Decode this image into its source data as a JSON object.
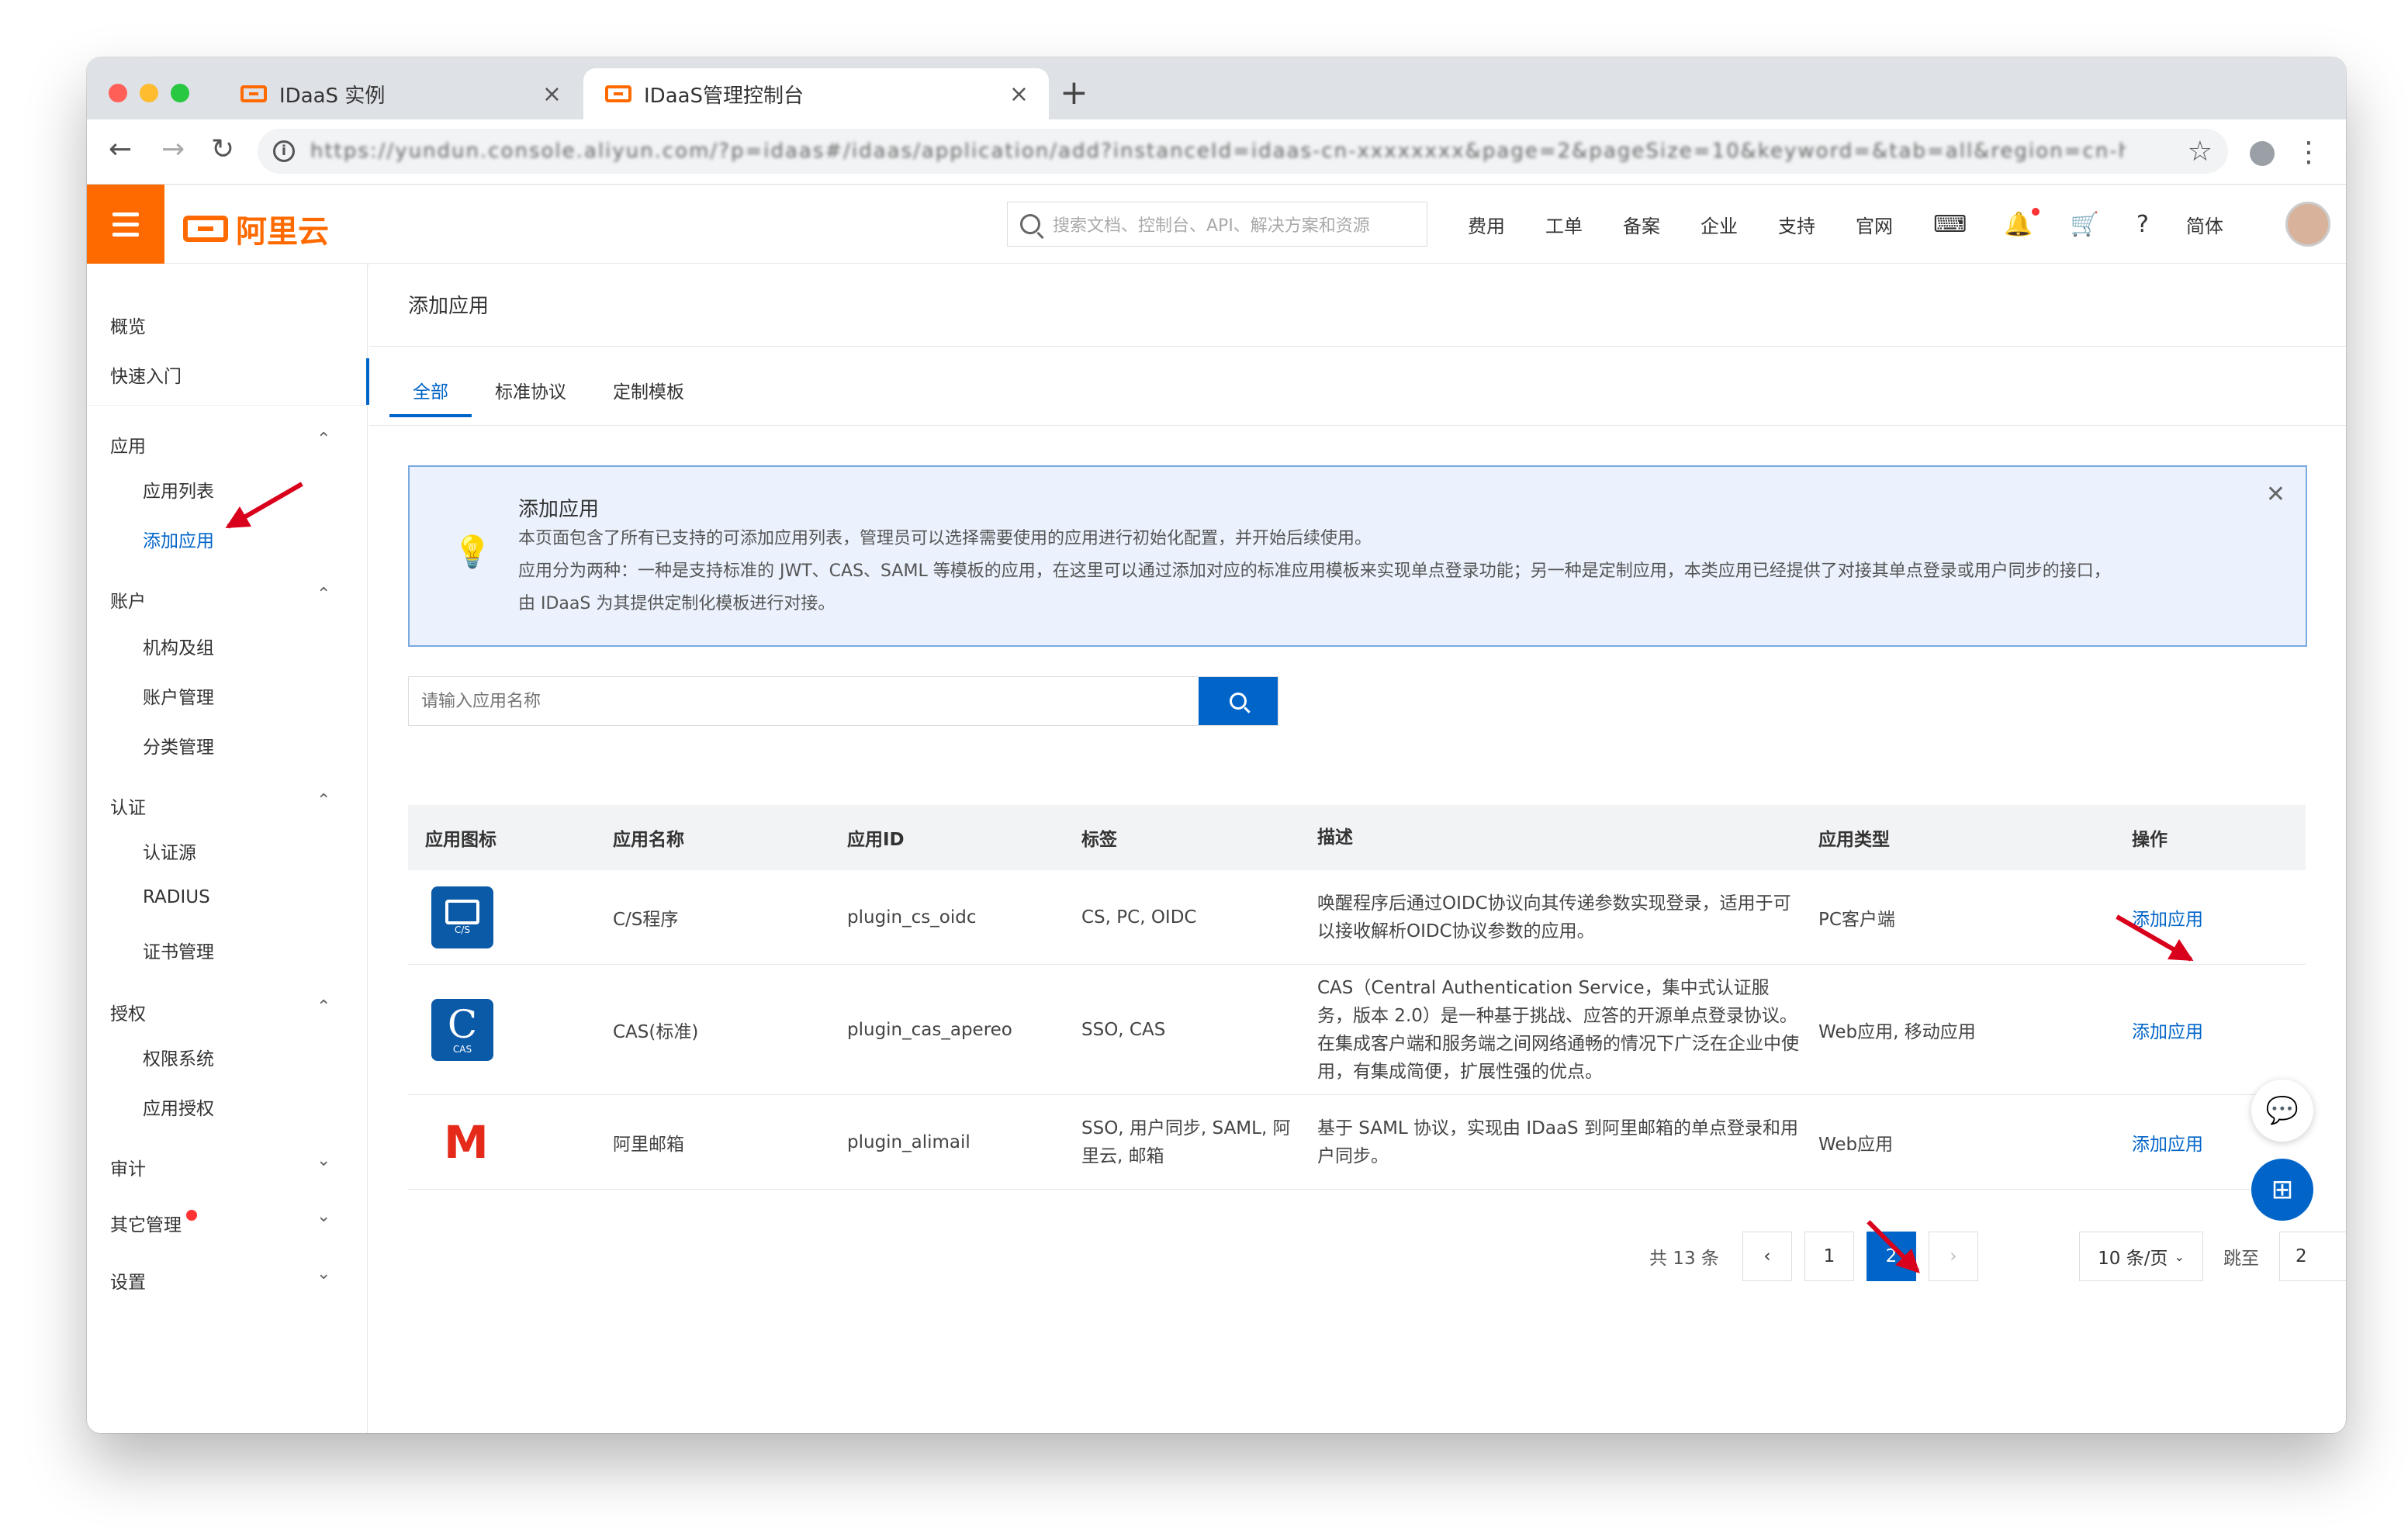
{
  "browser": {
    "tabs": [
      {
        "label": "IDaaS 实例",
        "active": false
      },
      {
        "label": "IDaaS管理控制台",
        "active": true
      }
    ],
    "url": "https://yundun.console.aliyun.com/?p=idaas#/idaas/application/add?instanceId=idaas-cn-xxxxxxxx&page=2&pageSize=10&keyword=&tab=all&region=cn-hangzhou"
  },
  "topbar": {
    "brand": "阿里云",
    "search_placeholder": "搜索文档、控制台、API、解决方案和资源",
    "nav": [
      "费用",
      "工单",
      "备案",
      "企业",
      "支持",
      "官网"
    ],
    "lang": "简体",
    "accent": "#ff6a00"
  },
  "sidebar": {
    "top_items": [
      "概览",
      "快速入门"
    ],
    "groups": [
      {
        "label": "应用",
        "expanded": true,
        "items": [
          "应用列表",
          "添加应用"
        ]
      },
      {
        "label": "账户",
        "expanded": true,
        "items": [
          "机构及组",
          "账户管理",
          "分类管理"
        ]
      },
      {
        "label": "认证",
        "expanded": true,
        "items": [
          "认证源",
          "RADIUS",
          "证书管理"
        ]
      },
      {
        "label": "授权",
        "expanded": true,
        "items": [
          "权限系统",
          "应用授权"
        ]
      },
      {
        "label": "审计",
        "expanded": false,
        "items": []
      },
      {
        "label": "其它管理",
        "expanded": false,
        "items": []
      },
      {
        "label": "设置",
        "expanded": false,
        "items": []
      }
    ],
    "active_item": "添加应用"
  },
  "page": {
    "title": "添加应用",
    "tabs": [
      "全部",
      "标准协议",
      "定制模板"
    ],
    "active_tab": "全部"
  },
  "notice": {
    "title": "添加应用",
    "line1": "本页面包含了所有已支持的可添加应用列表，管理员可以选择需要使用的应用进行初始化配置，并开始后续使用。",
    "line2": "应用分为两种：一种是支持标准的 JWT、CAS、SAML 等模板的应用，在这里可以通过添加对应的标准应用模板来实现单点登录功能；另一种是定制应用，本类应用已经提供了对接其单点登录或用户同步的接口，",
    "line3": "由 IDaaS 为其提供定制化模板进行对接。"
  },
  "search": {
    "placeholder": "请输入应用名称",
    "value": ""
  },
  "table": {
    "headers": [
      "应用图标",
      "应用名称",
      "应用ID",
      "标签",
      "描述",
      "应用类型",
      "操作"
    ],
    "rows": [
      {
        "icon": "cs-monitor-icon",
        "icon_text": "C/S",
        "name": "C/S程序",
        "id": "plugin_cs_oidc",
        "tags": "CS, PC, OIDC",
        "desc": "唤醒程序后通过OIDC协议向其传递参数实现登录，适用于可以接收解析OIDC协议参数的应用。",
        "type": "PC客户端",
        "action": "添加应用"
      },
      {
        "icon": "cas-icon",
        "icon_text": "C",
        "icon_sub": "CAS",
        "name": "CAS(标准)",
        "id": "plugin_cas_apereo",
        "tags": "SSO, CAS",
        "desc": "CAS（Central Authentication Service，集中式认证服务，版本 2.0）是一种基于挑战、应答的开源单点登录协议。在集成客户端和服务端之间网络通畅的情况下广泛在企业中使用，有集成简便，扩展性强的优点。",
        "type": "Web应用, 移动应用",
        "action": "添加应用"
      },
      {
        "icon": "alimail-icon",
        "icon_text": "M",
        "name": "阿里邮箱",
        "id": "plugin_alimail",
        "tags": "SSO, 用户同步, SAML, 阿里云, 邮箱",
        "desc": "基于 SAML 协议，实现由 IDaaS 到阿里邮箱的单点登录和用户同步。",
        "type": "Web应用",
        "action": "添加应用"
      }
    ]
  },
  "pagination": {
    "total": "共 13 条",
    "pages": [
      "1",
      "2"
    ],
    "current": "2",
    "page_size": "10 条/页",
    "jump_label": "跳至",
    "jump_value": "2"
  }
}
